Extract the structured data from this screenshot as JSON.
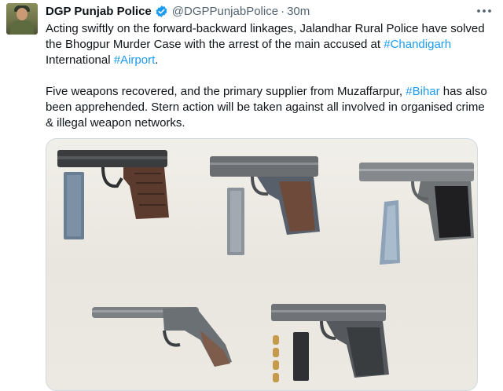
{
  "tweet": {
    "display_name": "DGP Punjab Police",
    "handle": "@DGPPunjabPolice",
    "separator": "·",
    "time": "30m",
    "verified_icon": "verified-badge-icon",
    "more_icon": "more-options-icon",
    "paragraph1": {
      "t1": "Acting swiftly on the forward-backward linkages, Jalandhar Rural Police have solved the Bhogpur Murder Case with the arrest of the main accused at ",
      "tag1": "#Chandigarh",
      "t2": " International ",
      "tag2": "#Airport",
      "t3": "."
    },
    "paragraph2": {
      "t1": "Five weapons recovered, and the primary supplier from Muzaffarpur, ",
      "tag1": "#Bihar",
      "t2": " has also been apprehended. Stern action will be taken against all involved in organised crime & illegal weapon networks."
    }
  },
  "colors": {
    "link": "#1d9bf0",
    "secondary_text": "#536471",
    "verified": "#1d9bf0"
  }
}
